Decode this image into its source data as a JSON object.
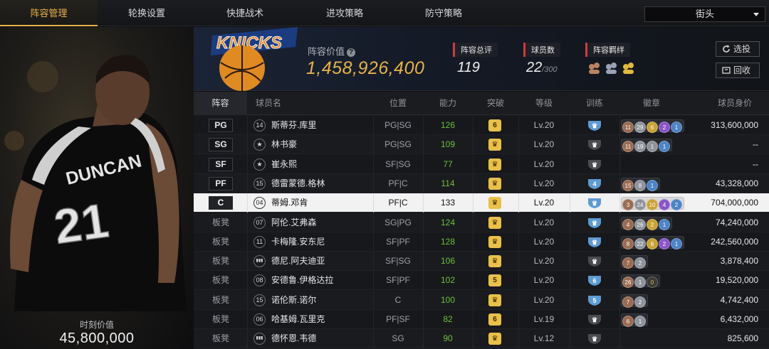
{
  "tabs": [
    {
      "label": "阵容管理",
      "active": true
    },
    {
      "label": "轮换设置",
      "active": false
    },
    {
      "label": "快捷战术",
      "active": false
    },
    {
      "label": "进攻策略",
      "active": false
    },
    {
      "label": "防守策略",
      "active": false
    }
  ],
  "dropdown": {
    "selected": "街头"
  },
  "player_card": {
    "jersey_name": "DUNCAN",
    "jersey_number": "21",
    "time_value_label": "时刻价值",
    "time_value": "45,800,000"
  },
  "summary": {
    "team_logo_text": "KNICKS",
    "lineup_value_label": "阵容价值",
    "lineup_value": "1,458,926,400",
    "overall_label": "阵容总评",
    "overall_value": "119",
    "count_label": "球员数",
    "count_value": "22",
    "count_max": "/300",
    "bond_label": "阵容羁绊",
    "select_button": "选投",
    "recycle_button": "回收"
  },
  "table": {
    "headers": [
      "阵容",
      "球员名",
      "位置",
      "能力",
      "突破",
      "等级",
      "训练",
      "徽章",
      "球员身价"
    ],
    "rows": [
      {
        "slot": "PG",
        "bench": false,
        "num": "14",
        "name": "斯蒂芬.库里",
        "pos": "PG|SG",
        "ability": "126",
        "breakthrough": "6",
        "level": "Lv.20",
        "train": "blue",
        "badges": [
          {
            "c": "bronze",
            "t": "11"
          },
          {
            "c": "silver",
            "t": "29"
          },
          {
            "c": "gold",
            "t": "6"
          },
          {
            "c": "purple",
            "t": "2"
          },
          {
            "c": "blue",
            "t": "1"
          }
        ],
        "value": "313,600,000"
      },
      {
        "slot": "SG",
        "bench": false,
        "num": "★",
        "name": "林书豪",
        "pos": "PG|SG",
        "ability": "109",
        "breakthrough": "crown",
        "level": "Lv.20",
        "train": "gray",
        "badges": [
          {
            "c": "bronze",
            "t": "11"
          },
          {
            "c": "silver",
            "t": "19"
          },
          {
            "c": "silver",
            "t": "1"
          },
          {
            "c": "blue",
            "t": "1"
          }
        ],
        "value": "--"
      },
      {
        "slot": "SF",
        "bench": false,
        "num": "★",
        "name": "崔永熙",
        "pos": "SF|SG",
        "ability": "77",
        "breakthrough": "crown",
        "level": "Lv.20",
        "train": "gray",
        "badges": [],
        "value": "--"
      },
      {
        "slot": "PF",
        "bench": false,
        "num": "15",
        "name": "德雷蒙德.格林",
        "pos": "PF|C",
        "ability": "114",
        "breakthrough": "crown",
        "level": "Lv.20",
        "train": "4",
        "badges": [
          {
            "c": "bronze",
            "t": "15"
          },
          {
            "c": "silver",
            "t": "8"
          },
          {
            "c": "blue",
            "t": "1"
          }
        ],
        "value": "43,328,000"
      },
      {
        "slot": "C",
        "bench": false,
        "selected": true,
        "num": "04",
        "name": "蒂姆.邓肯",
        "pos": "PF|C",
        "ability": "133",
        "breakthrough": "crown",
        "level": "Lv.20",
        "train": "blue",
        "badges": [
          {
            "c": "bronze",
            "t": "3"
          },
          {
            "c": "silver",
            "t": "24"
          },
          {
            "c": "gold",
            "t": "10"
          },
          {
            "c": "purple",
            "t": "4"
          },
          {
            "c": "blue",
            "t": "2"
          }
        ],
        "value": "704,000,000"
      },
      {
        "slot": "板凳",
        "bench": true,
        "num": "07",
        "name": "阿伦.艾弗森",
        "pos": "SG|PG",
        "ability": "124",
        "breakthrough": "crown",
        "level": "Lv.20",
        "train": "blue",
        "badges": [
          {
            "c": "bronze",
            "t": "4"
          },
          {
            "c": "silver",
            "t": "26"
          },
          {
            "c": "gold",
            "t": "2"
          },
          {
            "c": "blue",
            "t": "1"
          }
        ],
        "value": "74,240,000"
      },
      {
        "slot": "板凳",
        "bench": true,
        "num": "11",
        "name": "卡梅隆.安东尼",
        "pos": "SF|PF",
        "ability": "128",
        "breakthrough": "crown",
        "level": "Lv.20",
        "train": "blue",
        "badges": [
          {
            "c": "bronze",
            "t": "8"
          },
          {
            "c": "silver",
            "t": "22"
          },
          {
            "c": "gold",
            "t": "6"
          },
          {
            "c": "purple",
            "t": "2"
          },
          {
            "c": "blue",
            "t": "1"
          }
        ],
        "value": "242,560,000"
      },
      {
        "slot": "板凳",
        "bench": true,
        "num": "bars",
        "name": "德尼.阿夫迪亚",
        "pos": "SF|SG",
        "ability": "106",
        "breakthrough": "crown",
        "level": "Lv.20",
        "train": "gray",
        "badges": [
          {
            "c": "bronze",
            "t": "7"
          },
          {
            "c": "silver",
            "t": "2"
          }
        ],
        "value": "3,878,400"
      },
      {
        "slot": "板凳",
        "bench": true,
        "num": "08",
        "name": "安德鲁.伊格达拉",
        "pos": "SF|PF",
        "ability": "102",
        "breakthrough": "5",
        "level": "Lv.20",
        "train": "6",
        "badges": [
          {
            "c": "bronze",
            "t": "26"
          },
          {
            "c": "silver",
            "t": "1"
          },
          {
            "c": "dark",
            "t": "0"
          }
        ],
        "value": "19,520,000"
      },
      {
        "slot": "板凳",
        "bench": true,
        "num": "15",
        "name": "诺伦斯.诺尔",
        "pos": "C",
        "ability": "100",
        "breakthrough": "crown",
        "level": "Lv.20",
        "train": "5",
        "badges": [
          {
            "c": "bronze",
            "t": "7"
          },
          {
            "c": "silver",
            "t": "2"
          }
        ],
        "value": "4,742,400"
      },
      {
        "slot": "板凳",
        "bench": true,
        "num": "06",
        "name": "哈基姆.瓦里克",
        "pos": "PF|SF",
        "ability": "82",
        "breakthrough": "6",
        "level": "Lv.19",
        "train": "gray",
        "badges": [
          {
            "c": "bronze",
            "t": "6"
          },
          {
            "c": "silver",
            "t": "1"
          }
        ],
        "value": "6,432,000"
      },
      {
        "slot": "板凳",
        "bench": true,
        "num": "bars",
        "name": "德怀恩.韦德",
        "pos": "SG",
        "ability": "90",
        "breakthrough": "crown",
        "level": "Lv.12",
        "train": "gray",
        "badges": [],
        "value": "825,600"
      }
    ]
  },
  "colors": {
    "accent": "#e7b24a",
    "ability_green": "#6cc13a",
    "tag_red": "#d23a3a"
  }
}
